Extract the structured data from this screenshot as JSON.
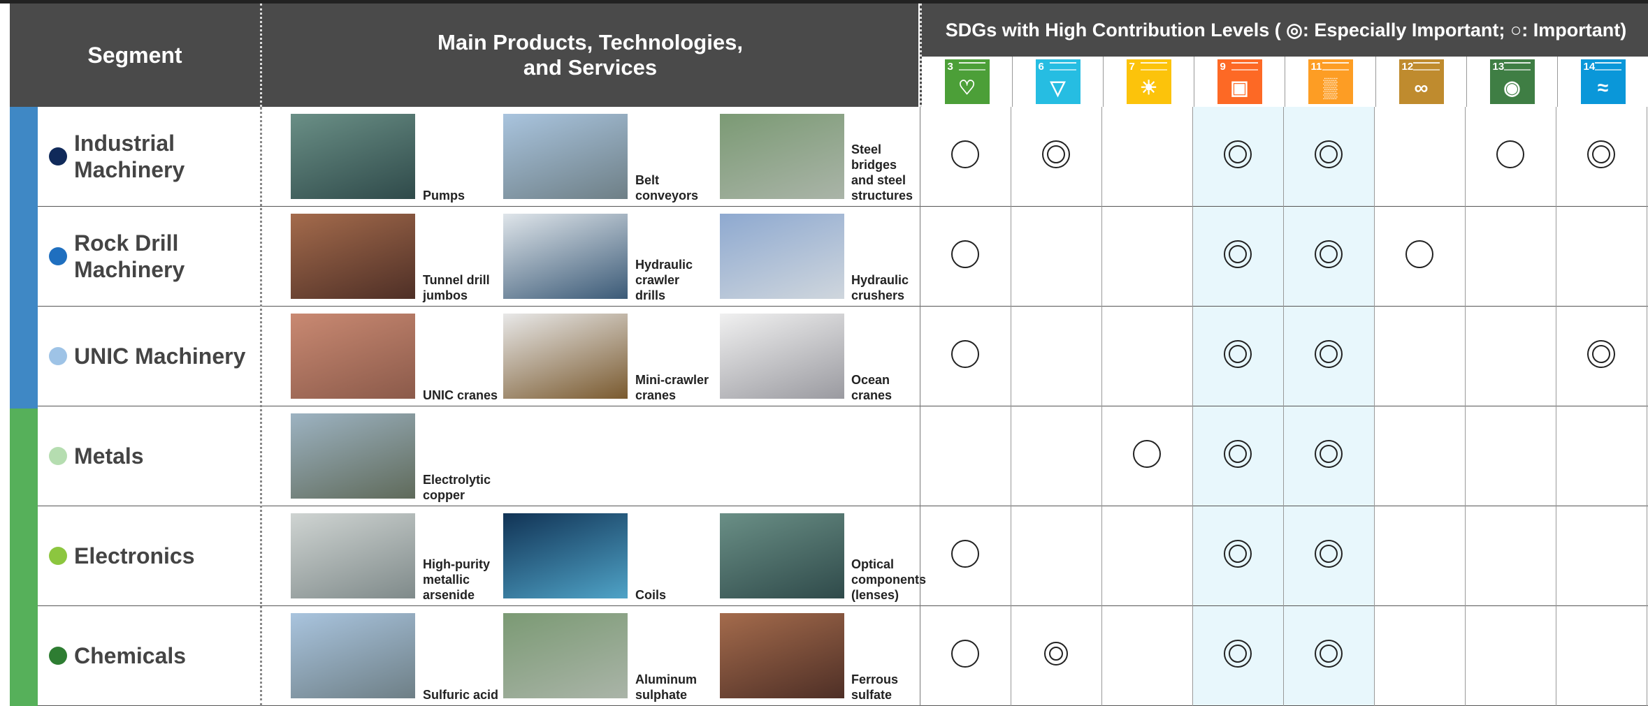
{
  "header": {
    "segment": "Segment",
    "products_line1": "Main Products, Technologies,",
    "products_line2": "and Services",
    "sdg_title": "SDGs with High Contribution Levels ( ◎: Especially Important; ○: Important)"
  },
  "sdg_goals": [
    {
      "number": "3",
      "color": "#4c9f38",
      "icon": "health-pulse-icon",
      "glyph": "♡"
    },
    {
      "number": "6",
      "color": "#26bde2",
      "icon": "water-drop-icon",
      "glyph": "▽"
    },
    {
      "number": "7",
      "color": "#fcc30b",
      "icon": "sun-energy-icon",
      "glyph": "☀"
    },
    {
      "number": "9",
      "color": "#fd6925",
      "icon": "industry-cubes-icon",
      "glyph": "▣"
    },
    {
      "number": "11",
      "color": "#fd9d24",
      "icon": "city-buildings-icon",
      "glyph": "▒"
    },
    {
      "number": "12",
      "color": "#bf8b2e",
      "icon": "infinity-icon",
      "glyph": "∞"
    },
    {
      "number": "13",
      "color": "#3f7e44",
      "icon": "eye-climate-icon",
      "glyph": "◉"
    },
    {
      "number": "14",
      "color": "#0a97d9",
      "icon": "fish-water-icon",
      "glyph": "≈"
    }
  ],
  "legend": {
    "especially_important": "◎",
    "important": "○"
  },
  "segments": [
    {
      "name": "Industrial Machinery",
      "dot_color": "#102a5a",
      "products": [
        "Pumps",
        "Belt conveyors",
        "Steel bridges and steel structures"
      ],
      "marks": [
        "important",
        "especially",
        "",
        "especially",
        "especially",
        "",
        "important",
        "especially"
      ]
    },
    {
      "name": "Rock Drill Machinery",
      "dot_color": "#1f6fbf",
      "products": [
        "Tunnel drill jumbos",
        "Hydraulic crawler drills",
        "Hydraulic crushers"
      ],
      "marks": [
        "important",
        "",
        "",
        "especially",
        "especially",
        "important",
        "",
        ""
      ]
    },
    {
      "name": "UNIC Machinery",
      "dot_color": "#9ec3e6",
      "products": [
        "UNIC cranes",
        "Mini-crawler cranes",
        "Ocean cranes"
      ],
      "marks": [
        "important",
        "",
        "",
        "especially",
        "especially",
        "",
        "",
        "especially"
      ]
    },
    {
      "name": "Metals",
      "dot_color": "#b5ddb0",
      "products": [
        "Electrolytic copper"
      ],
      "marks": [
        "",
        "",
        "important",
        "especially",
        "especially",
        "",
        "",
        ""
      ]
    },
    {
      "name": "Electronics",
      "dot_color": "#8cc63f",
      "products": [
        "High-purity metallic arsenide",
        "Coils",
        "Optical components (lenses)"
      ],
      "marks": [
        "important",
        "",
        "",
        "especially",
        "especially",
        "",
        "",
        ""
      ]
    },
    {
      "name": "Chemicals",
      "dot_color": "#2e7d32",
      "products": [
        "Sulfuric acid",
        "Aluminum sulphate",
        "Ferrous sulfate"
      ],
      "marks": [
        "important",
        "especially-small",
        "",
        "especially",
        "especially",
        "",
        "",
        ""
      ]
    }
  ]
}
